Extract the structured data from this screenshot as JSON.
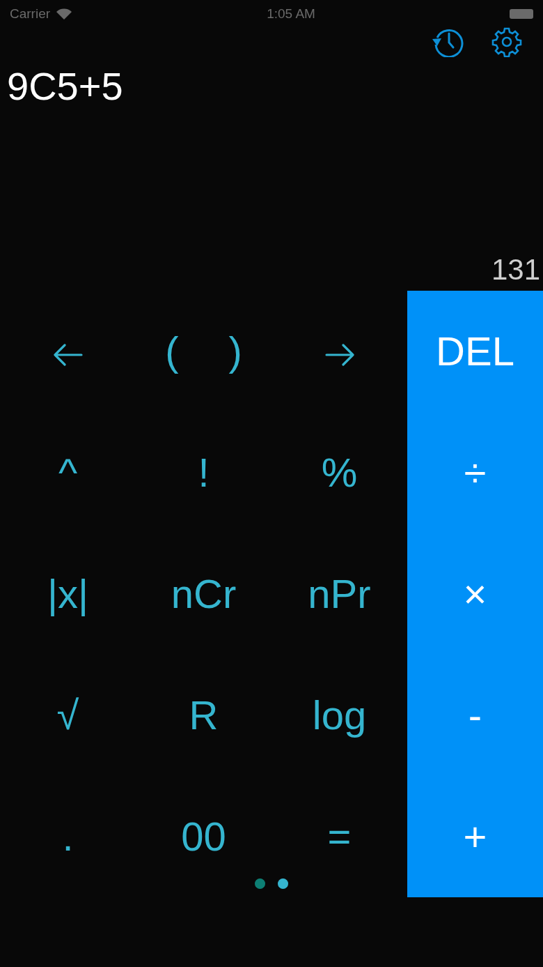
{
  "status_bar": {
    "carrier": "Carrier",
    "time": "1:05 AM"
  },
  "display": {
    "expression": "9C5+5",
    "result": "131"
  },
  "keys": [
    [
      {
        "kind": "arrow-left"
      },
      {
        "kind": "pair",
        "labels": [
          "(",
          ")"
        ]
      },
      {
        "kind": "arrow-right"
      }
    ],
    [
      {
        "kind": "text",
        "label": "^"
      },
      {
        "kind": "text",
        "label": "!"
      },
      {
        "kind": "text",
        "label": "%"
      }
    ],
    [
      {
        "kind": "text",
        "label": "|x|"
      },
      {
        "kind": "text",
        "label": "nCr"
      },
      {
        "kind": "text",
        "label": "nPr"
      }
    ],
    [
      {
        "kind": "text",
        "label": "√"
      },
      {
        "kind": "text",
        "label": "R"
      },
      {
        "kind": "text",
        "label": "log"
      }
    ],
    [
      {
        "kind": "text",
        "label": "."
      },
      {
        "kind": "text",
        "label": "00"
      },
      {
        "kind": "text",
        "label": "="
      }
    ]
  ],
  "operators": [
    "DEL",
    "÷",
    "×",
    "-",
    "+"
  ],
  "pages": [
    {
      "selected": false
    },
    {
      "selected": true
    }
  ]
}
